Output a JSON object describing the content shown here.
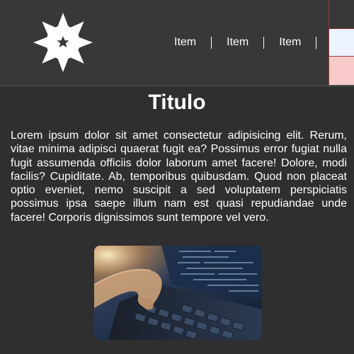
{
  "header": {
    "logo_icon": "star-burst-icon",
    "nav": {
      "items": [
        "Item",
        "Item",
        "Item"
      ]
    },
    "side_panel_colors": [
      "#383838",
      "#eef4ff",
      "#f7c9c9"
    ]
  },
  "main": {
    "title": "Titulo",
    "paragraph": "Lorem ipsum dolor sit amet consectetur adipisicing elit. Rerum, vitae minima adipisci quaerat fugit ea? Possimus error fugiat nulla fugit assumenda officiis dolor laborum amet facere! Dolore, modi facilis? Cupiditate. Ab, temporibus quibusdam. Quod non placeat optio eveniet, nemo suscipit a sed voluptatem perspiciatis possimus ipsa saepe illum nam est quasi repudiandae unde facere! Corporis dignissimos sunt tempore vel vero.",
    "image": "photo-hands-typing-on-laptop-keyboard"
  },
  "colors": {
    "background": "#2f2f2f",
    "header": "#383838",
    "text": "#ffffff"
  }
}
